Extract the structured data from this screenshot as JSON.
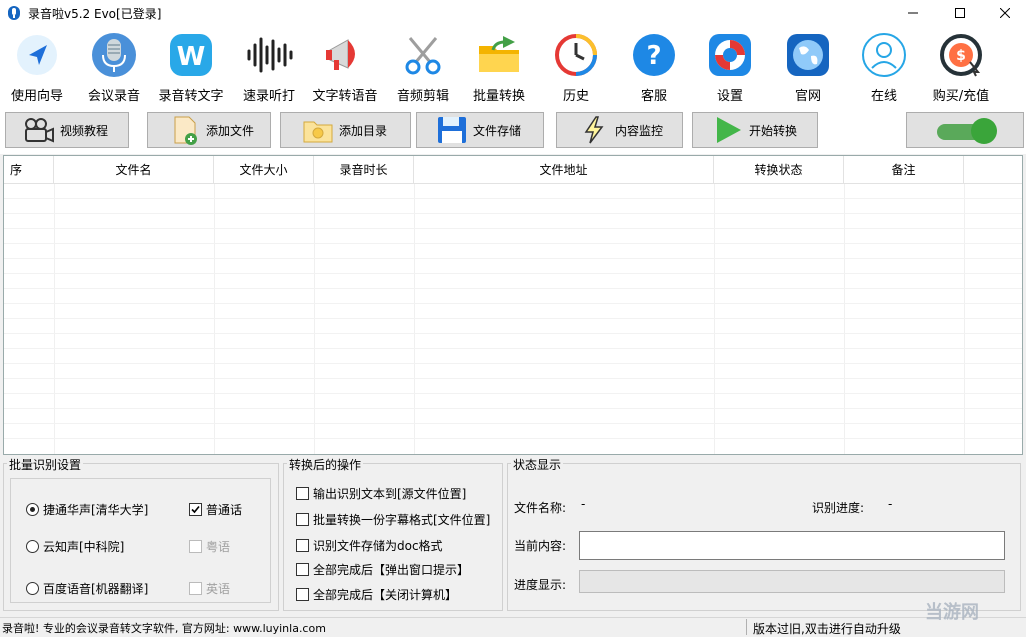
{
  "window": {
    "title": "录音啦v5.2 Evo[已登录]",
    "controls": [
      "minimize",
      "maximize",
      "close"
    ]
  },
  "toolbar": {
    "items": [
      {
        "label": "使用向导",
        "icon": "navigation-arrow-icon"
      },
      {
        "label": "会议录音",
        "icon": "microphone-icon"
      },
      {
        "label": "录音转文字",
        "icon": "w-word-icon"
      },
      {
        "label": "速录听打",
        "icon": "waveform-icon"
      },
      {
        "label": "文字转语音",
        "icon": "megaphone-icon"
      },
      {
        "label": "音频剪辑",
        "icon": "scissors-icon"
      },
      {
        "label": "批量转换",
        "icon": "folder-refresh-icon"
      },
      {
        "label": "历史",
        "icon": "history-clock-icon"
      },
      {
        "label": "客服",
        "icon": "help-question-icon"
      },
      {
        "label": "设置",
        "icon": "lifebuoy-icon"
      },
      {
        "label": "官网",
        "icon": "globe-icon"
      },
      {
        "label": "在线",
        "icon": "user-online-icon"
      },
      {
        "label": "购买/充值",
        "icon": "dollar-coin-icon"
      }
    ]
  },
  "actions": {
    "video_tutorial": "视频教程",
    "add_file": "添加文件",
    "add_dir": "添加目录",
    "file_storage": "文件存储",
    "content_monitor": "内容监控",
    "start_convert": "开始转换",
    "toggle_on": true
  },
  "table": {
    "columns": [
      "序",
      "文件名",
      "文件大小",
      "录音时长",
      "文件地址",
      "转换状态",
      "备注"
    ],
    "rows": []
  },
  "batch_settings": {
    "title": "批量识别设置",
    "engines": [
      {
        "label": "捷通华声[清华大学]",
        "selected": true
      },
      {
        "label": "云知声[中科院]",
        "selected": false
      },
      {
        "label": "百度语音[机器翻译]",
        "selected": false
      }
    ],
    "languages": [
      {
        "label": "普通话",
        "checked": true,
        "enabled": true
      },
      {
        "label": "粤语",
        "checked": false,
        "enabled": false
      },
      {
        "label": "英语",
        "checked": false,
        "enabled": false
      }
    ]
  },
  "post_ops": {
    "title": "转换后的操作",
    "options": [
      {
        "label": "输出识别文本到[源文件位置]",
        "checked": false
      },
      {
        "label": "批量转换一份字幕格式[文件位置]",
        "checked": false
      },
      {
        "label": "识别文件存储为doc格式",
        "checked": false
      },
      {
        "label": "全部完成后【弹出窗口提示】",
        "checked": false
      },
      {
        "label": "全部完成后【关闭计算机】",
        "checked": false
      }
    ]
  },
  "status": {
    "title": "状态显示",
    "file_name_label": "文件名称:",
    "file_name_value": "-",
    "progress_label": "识别进度:",
    "progress_value": "-",
    "current_label": "当前内容:",
    "current_value": "",
    "progress_display_label": "进度显示:",
    "progress_fraction": 0
  },
  "statusbar": {
    "left": "录音啦! 专业的会议录音转文字软件, 官方网址: www.luyinla.com",
    "right": "版本过旧,双击进行自动升级"
  },
  "watermark": "当游网",
  "colors": {
    "accent_blue": "#1e88e5",
    "toggle_green": "#3aa53a"
  }
}
